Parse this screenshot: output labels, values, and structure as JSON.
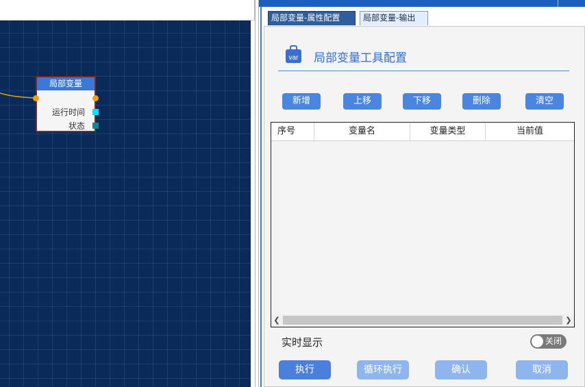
{
  "canvas": {
    "node": {
      "title": "局部变量",
      "outputs": [
        "运行时间",
        "状态"
      ]
    }
  },
  "panel": {
    "tabs": [
      {
        "label": "局部变量-属性配置",
        "active": true
      },
      {
        "label": "局部变量-输出",
        "active": false
      }
    ],
    "icon_text": "var",
    "title": "局部变量工具配置",
    "toolbar": {
      "add": "新增",
      "move_up": "上移",
      "move_down": "下移",
      "delete": "删除",
      "clear": "清空"
    },
    "table": {
      "columns": [
        "序号",
        "变量名",
        "变量类型",
        "当前值"
      ],
      "rows": []
    },
    "realtime": {
      "label": "实时显示",
      "toggle_label": "关闭",
      "toggle_on": false
    },
    "actions": {
      "execute": "执行",
      "loop_execute": "循环执行",
      "confirm": "确认",
      "cancel": "取消"
    }
  },
  "colors": {
    "canvas_bg": "#0a2a5a",
    "accent": "#4a86e0",
    "node_header": "#3c78d8",
    "port": "#f2a000",
    "toggle_off": "#7a7a7a"
  }
}
